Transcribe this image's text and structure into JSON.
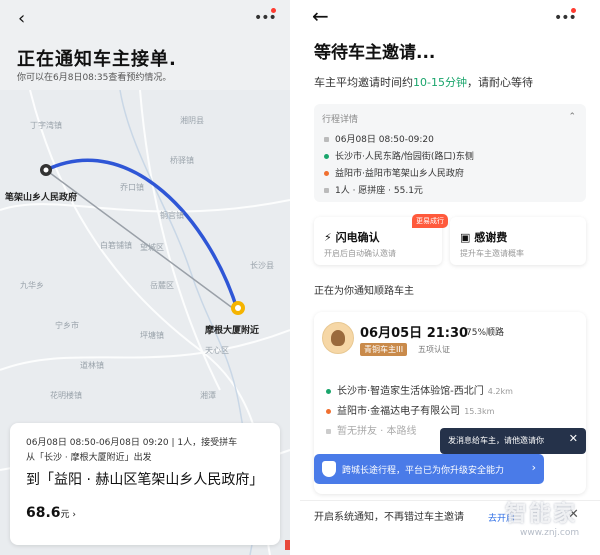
{
  "left": {
    "title": "正在通知车主接单.",
    "subtitle": "你可以在6月8日08:35查看预约情况。",
    "map_labels": {
      "origin": "笔架山乡人民政府",
      "destination": "摩根大厦附近",
      "places": [
        "丁字湾镇",
        "乔口镇",
        "桥驿镇",
        "湘阴县",
        "铜官镇",
        "白箬铺镇",
        "望城区",
        "长沙县",
        "九华乡",
        "宁乡市",
        "天心区",
        "湘潭",
        "花明楼镇",
        "道林镇",
        "岳麓区",
        "坪塘镇"
      ]
    },
    "card": {
      "line1": "06月08日 08:50-06月08日 09:20 | 1人，接受拼车",
      "line2": "从「长沙 · 摩根大厦附近」出发",
      "dest": "到「益阳 · 赫山区笔架山乡人民政府」",
      "price": "68.6",
      "price_unit": "元 ›"
    }
  },
  "right": {
    "title": "等待车主邀请...",
    "wait_prefix": "车主平均邀请时间约",
    "wait_highlight": "10-15分钟",
    "wait_suffix": "，请耐心等待",
    "trip": {
      "header": "行程详情",
      "time": "06月08日 08:50-09:20",
      "from": "长沙市·人民东路/怡园街(路口)东侧",
      "to": "益阳市·益阳市笔架山乡人民政府",
      "seats": "1人 · 愿拼座 · 55.1元"
    },
    "options": [
      {
        "title": "闪电确认",
        "subtitle": "开启后自动确认邀请",
        "badge": "更易成行"
      },
      {
        "title": "感谢费",
        "subtitle": "提升车主邀请概率"
      }
    ],
    "notify_text": "正在为你通知顺路车主",
    "driver": {
      "time": "06月05日 21:30",
      "match": "75%顺路",
      "tier": "青铜车主III",
      "verify": "五项认证",
      "from": "长沙市·智造家生活体验馆-西北门",
      "from_km": "4.2km",
      "to": "益阳市·金福达电子有限公司",
      "to_km": "15.3km",
      "extra": "暂无拼友 · 本路线"
    },
    "tip_dark": "发消息给车主，请他邀请你",
    "tip_blue": "跨城长途行程，平台已为你升级安全能力",
    "bottom_bar": {
      "text": "开启系统通知，不再错过车主邀请",
      "action": "去开启"
    },
    "watermark": "智能家",
    "watermark_url": "www.znj.com"
  },
  "colors": {
    "route": "#2f56d6",
    "green": "#1aa56c",
    "orange_dot": "#f07030",
    "pin_dest": "#f5b400"
  }
}
